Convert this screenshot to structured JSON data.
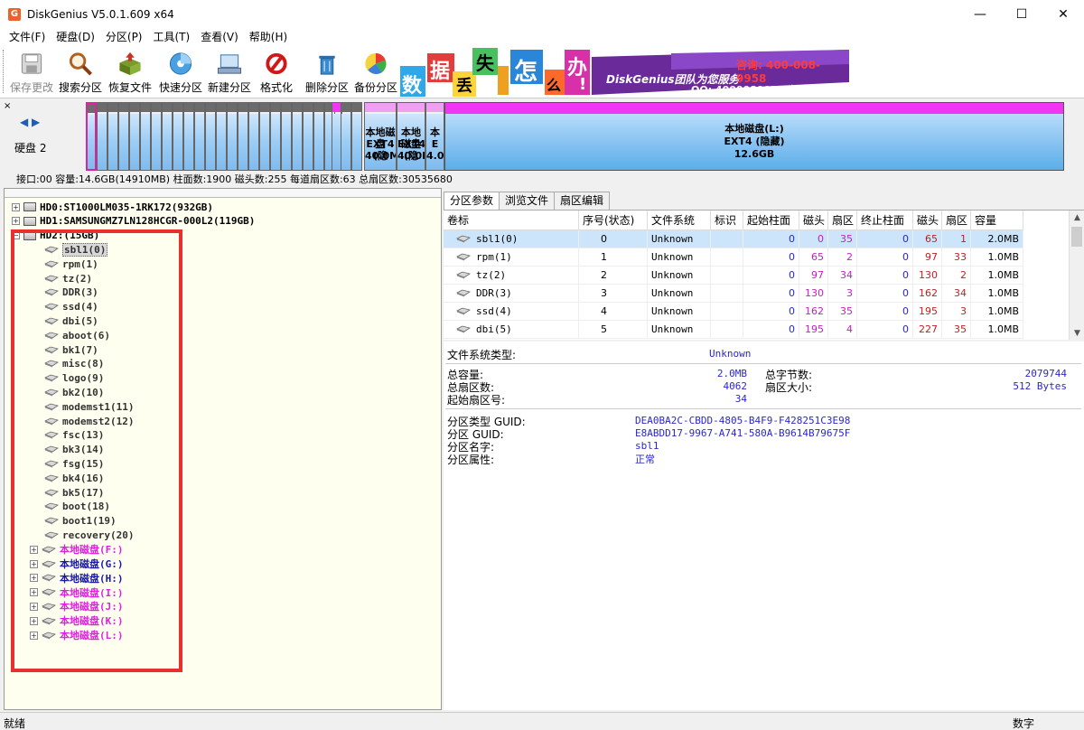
{
  "window": {
    "title": "DiskGenius V5.0.1.609 x64",
    "icon_letter": "G",
    "minimize": "—",
    "maximize": "☐",
    "close": "✕"
  },
  "menu": [
    "文件(F)",
    "硬盘(D)",
    "分区(P)",
    "工具(T)",
    "查看(V)",
    "帮助(H)"
  ],
  "toolbar": {
    "buttons": [
      {
        "label": "保存更改",
        "icon": "save-icon"
      },
      {
        "label": "搜索分区",
        "icon": "magnifier-icon"
      },
      {
        "label": "恢复文件",
        "icon": "recover-box-icon"
      },
      {
        "label": "快速分区",
        "icon": "quick-partition-disc-icon"
      },
      {
        "label": "新建分区",
        "icon": "new-partition-icon"
      },
      {
        "label": "格式化",
        "icon": "format-icon"
      },
      {
        "label": "删除分区",
        "icon": "trash-icon"
      },
      {
        "label": "备份分区",
        "icon": "backup-icon"
      }
    ],
    "banner": {
      "chars": [
        "数",
        "据",
        "丢",
        "失",
        "怎",
        "么",
        "办",
        "!"
      ],
      "team": "DiskGenius团队为您服务",
      "phone": "咨询: 400-008-9958",
      "qq": "QQ: 4000089958(与电话同号)"
    }
  },
  "disk_map": {
    "close": "×",
    "nav": "◀ ▶",
    "label": "硬盘 2",
    "small_parts": [
      {
        "name": "本地磁盘",
        "fs": "EXT4 (隐",
        "size": "40.0M"
      },
      {
        "name": "本地磁盘",
        "fs": "EXT4 (隐",
        "size": "40.0M"
      },
      {
        "name": "本",
        "fs": "E",
        "size": "4.0"
      }
    ],
    "big_part": {
      "name": "本地磁盘(L:)",
      "fs": "EXT4 (隐藏)",
      "size": "12.6GB"
    },
    "info": "接口:00  容量:14.6GB(14910MB)  柱面数:1900  磁头数:255  每道扇区数:63  总扇区数:30535680"
  },
  "tree": {
    "disks": [
      {
        "label": "HD0:ST1000LM035-1RK172(932GB)",
        "expander": "+"
      },
      {
        "label": "HD1:SAMSUNGMZ7LN128HCGR-000L2(119GB)",
        "expander": "+"
      },
      {
        "label": "HD2:(15GB)",
        "expander": "−"
      }
    ],
    "partitions": [
      "sbl1(0)",
      "rpm(1)",
      "tz(2)",
      "DDR(3)",
      "ssd(4)",
      "dbi(5)",
      "aboot(6)",
      "bk1(7)",
      "misc(8)",
      "logo(9)",
      "bk2(10)",
      "modemst1(11)",
      "modemst2(12)",
      "fsc(13)",
      "bk3(14)",
      "fsg(15)",
      "bk4(16)",
      "bk5(17)",
      "boot(18)",
      "boot1(19)",
      "recovery(20)"
    ],
    "volumes": [
      {
        "label": "本地磁盘(F:)",
        "color": "#e020e0"
      },
      {
        "label": "本地磁盘(G:)",
        "color": "#1818a8"
      },
      {
        "label": "本地磁盘(H:)",
        "color": "#1818a8"
      },
      {
        "label": "本地磁盘(I:)",
        "color": "#e020e0"
      },
      {
        "label": "本地磁盘(J:)",
        "color": "#e020e0"
      },
      {
        "label": "本地磁盘(K:)",
        "color": "#e020e0"
      },
      {
        "label": "本地磁盘(L:)",
        "color": "#e020e0"
      }
    ]
  },
  "tabs": [
    "分区参数",
    "浏览文件",
    "扇区编辑"
  ],
  "grid": {
    "columns": [
      "卷标",
      "序号(状态)",
      "文件系统",
      "标识",
      "起始柱面",
      "磁头",
      "扇区",
      "终止柱面",
      "磁头",
      "扇区",
      "容量"
    ],
    "rows": [
      [
        "sbl1(0)",
        "0",
        "Unknown",
        "",
        "0",
        "0",
        "35",
        "0",
        "65",
        "1",
        "2.0MB"
      ],
      [
        "rpm(1)",
        "1",
        "Unknown",
        "",
        "0",
        "65",
        "2",
        "0",
        "97",
        "33",
        "1.0MB"
      ],
      [
        "tz(2)",
        "2",
        "Unknown",
        "",
        "0",
        "97",
        "34",
        "0",
        "130",
        "2",
        "1.0MB"
      ],
      [
        "DDR(3)",
        "3",
        "Unknown",
        "",
        "0",
        "130",
        "3",
        "0",
        "162",
        "34",
        "1.0MB"
      ],
      [
        "ssd(4)",
        "4",
        "Unknown",
        "",
        "0",
        "162",
        "35",
        "0",
        "195",
        "3",
        "1.0MB"
      ],
      [
        "dbi(5)",
        "5",
        "Unknown",
        "",
        "0",
        "195",
        "4",
        "0",
        "227",
        "35",
        "1.0MB"
      ]
    ],
    "scroll_up": "▲",
    "scroll_down": "▼"
  },
  "details": {
    "fs_type_label": "文件系统类型:",
    "fs_type_value": "Unknown",
    "total_capacity_label": "总容量:",
    "total_capacity_value": "2.0MB",
    "total_sectors_label": "总扇区数:",
    "total_sectors_value": "4062",
    "start_sector_label": "起始扇区号:",
    "start_sector_value": "34",
    "total_bytes_label": "总字节数:",
    "total_bytes_value": "2079744",
    "sector_size_label": "扇区大小:",
    "sector_size_value": "512 Bytes",
    "type_guid_label": "分区类型 GUID:",
    "type_guid_value": "DEA0BA2C-CBDD-4805-B4F9-F428251C3E98",
    "part_guid_label": "分区 GUID:",
    "part_guid_value": "E8ABDD17-9967-A741-580A-B9614B79675F",
    "part_name_label": "分区名字:",
    "part_name_value": "sbl1",
    "part_attr_label": "分区属性:",
    "part_attr_value": "正常"
  },
  "status": {
    "left": "就绪",
    "right": "数字"
  }
}
